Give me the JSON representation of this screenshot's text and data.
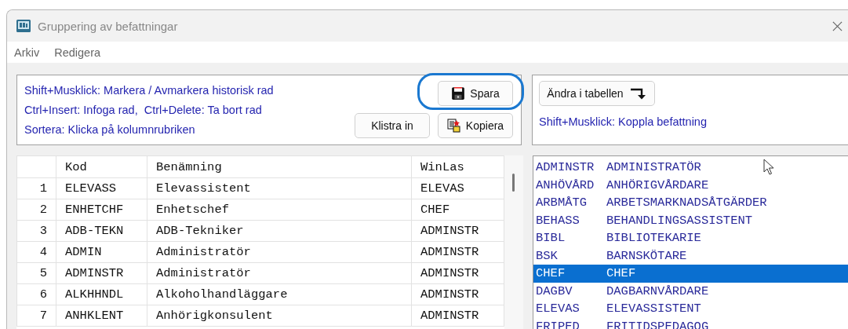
{
  "window": {
    "title": "Gruppering av befattningar"
  },
  "menu": [
    "Arkiv",
    "Redigera"
  ],
  "help_lines": [
    "Shift+Musklick: Markera / Avmarkera historisk rad",
    "Ctrl+Insert: Infoga rad,  Ctrl+Delete: Ta bort rad",
    "Sortera: Klicka på kolumnrubriken"
  ],
  "buttons": [
    {
      "kind": "save",
      "label": "Spara",
      "highlighted": true
    },
    {
      "kind": "paste",
      "label": "Klistra in",
      "highlighted": false
    },
    {
      "kind": "copy",
      "label": "Kopiera",
      "highlighted": false
    }
  ],
  "right_panel": {
    "button": "Ändra i tabellen",
    "hint": "Shift+Musklick: Koppla befattning"
  },
  "table": {
    "columns": [
      "Kod",
      "Benämning",
      "WinLas"
    ],
    "rows": [
      {
        "number": "1",
        "kod": "ELEVASS",
        "benamning": "Elevassistent",
        "winlas": "ELEVAS"
      },
      {
        "number": "2",
        "kod": "ENHETCHF",
        "benamning": "Enhetschef",
        "winlas": "CHEF"
      },
      {
        "number": "3",
        "kod": "ADB-TEKN",
        "benamning": "ADB-Tekniker",
        "winlas": "ADMINSTR"
      },
      {
        "number": "4",
        "kod": "ADMIN",
        "benamning": "Administratör",
        "winlas": "ADMINSTR"
      },
      {
        "number": "5",
        "kod": "ADMINSTR",
        "benamning": "Administratör",
        "winlas": "ADMINSTR"
      },
      {
        "number": "6",
        "kod": "ALKHHNDL",
        "benamning": "Alkoholhandläggare",
        "winlas": "ADMINSTR"
      },
      {
        "number": "7",
        "kod": "ANHKLENT",
        "benamning": "Anhörigkonsulent",
        "winlas": "ADMINSTR"
      }
    ]
  },
  "winlas_list": [
    {
      "code": "ADMINSTR",
      "name": "ADMINISTRATÖR",
      "selected": false
    },
    {
      "code": "ANHÖVÅRD",
      "name": "ANHÖRIGVÅRDARE",
      "selected": false
    },
    {
      "code": "ARBMÅTG",
      "name": "ARBETSMARKNADSÅTGÄRDER",
      "selected": false
    },
    {
      "code": "BEHASS",
      "name": "BEHANDLINGSASSISTENT",
      "selected": false
    },
    {
      "code": "BIBL",
      "name": "BIBLIOTEKARIE",
      "selected": false
    },
    {
      "code": "BSK",
      "name": "BARNSKÖTARE",
      "selected": false
    },
    {
      "code": "CHEF",
      "name": "CHEF",
      "selected": true
    },
    {
      "code": "DAGBV",
      "name": "DAGBARNVÅRDARE",
      "selected": false
    },
    {
      "code": "ELEVAS",
      "name": "ELEVASSISTENT",
      "selected": false
    },
    {
      "code": "FRIPED",
      "name": "FRITIDSPEDAGOG",
      "selected": false
    }
  ]
}
